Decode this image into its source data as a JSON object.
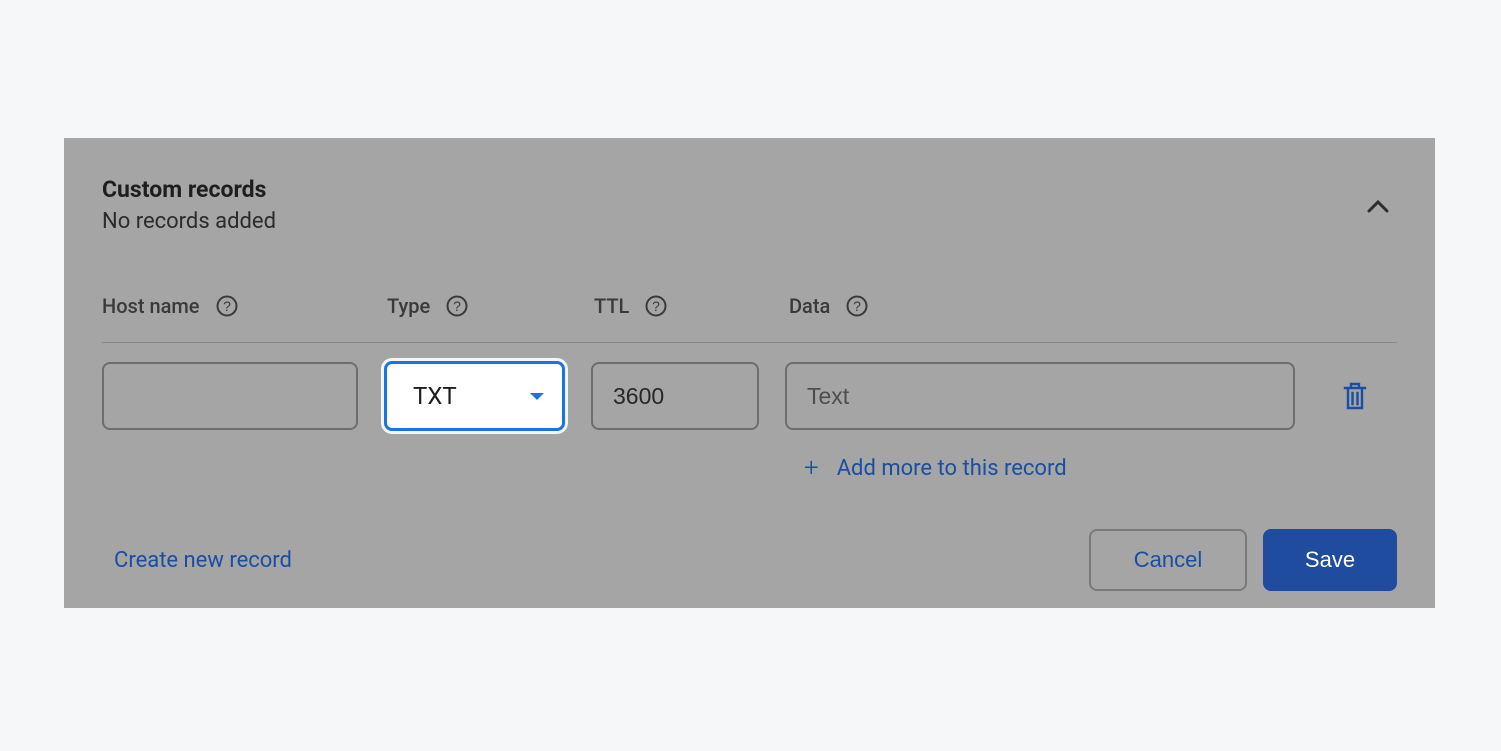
{
  "header": {
    "title": "Custom records",
    "subtitle": "No records added"
  },
  "columns": {
    "hostname": "Host name",
    "type": "Type",
    "ttl": "TTL",
    "data": "Data"
  },
  "row": {
    "hostname_value": "",
    "type_value": "TXT",
    "ttl_value": "3600",
    "data_placeholder": "Text"
  },
  "actions": {
    "add_more": "Add more to this record",
    "create_new": "Create new record",
    "cancel": "Cancel",
    "save": "Save"
  }
}
